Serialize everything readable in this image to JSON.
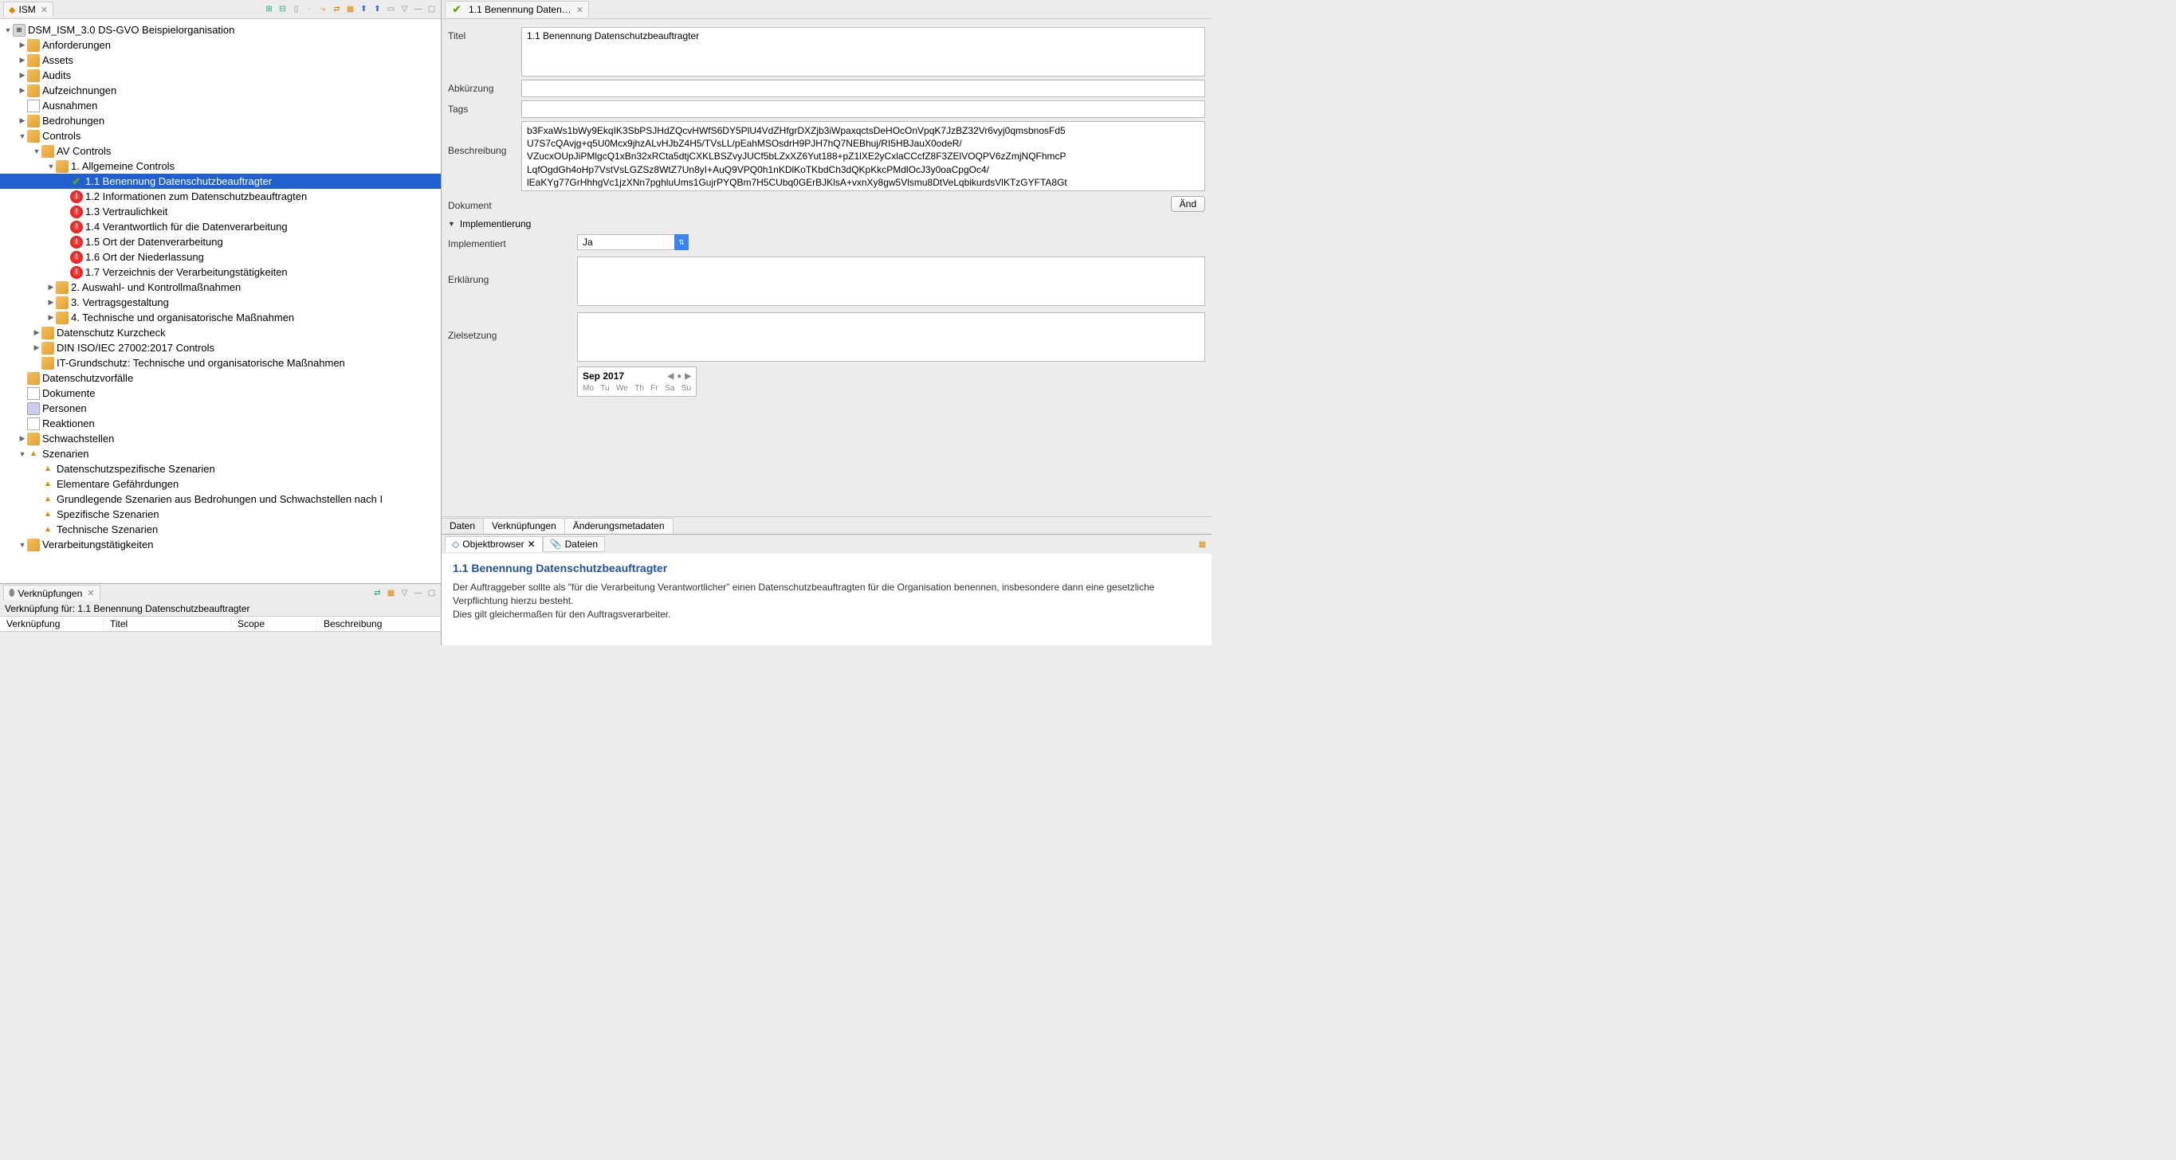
{
  "left": {
    "tab_label": "ISM",
    "tree": {
      "root": "DSM_ISM_3.0 DS-GVO Beispielorganisation",
      "items": [
        {
          "d": 1,
          "t": "Anforderungen",
          "i": "folder",
          "a": ">"
        },
        {
          "d": 1,
          "t": "Assets",
          "i": "folder",
          "a": ">"
        },
        {
          "d": 1,
          "t": "Audits",
          "i": "folder",
          "a": ">"
        },
        {
          "d": 1,
          "t": "Aufzeichnungen",
          "i": "folder",
          "a": ">"
        },
        {
          "d": 1,
          "t": "Ausnahmen",
          "i": "doc",
          "a": ""
        },
        {
          "d": 1,
          "t": "Bedrohungen",
          "i": "folder",
          "a": ">"
        },
        {
          "d": 1,
          "t": "Controls",
          "i": "folder",
          "a": "v"
        },
        {
          "d": 2,
          "t": "AV Controls",
          "i": "folder",
          "a": "v"
        },
        {
          "d": 3,
          "t": "1. Allgemeine Controls",
          "i": "folder",
          "a": "v"
        },
        {
          "d": 4,
          "t": "1.1 Benennung Datenschutzbeauftragter",
          "i": "chk",
          "a": "",
          "sel": true
        },
        {
          "d": 4,
          "t": "1.2 Informationen zum Datenschutzbeauftragten",
          "i": "err",
          "a": ""
        },
        {
          "d": 4,
          "t": "1.3 Vertraulichkeit",
          "i": "err",
          "a": ""
        },
        {
          "d": 4,
          "t": "1.4 Verantwortlich für die Datenverarbeitung",
          "i": "err",
          "a": ""
        },
        {
          "d": 4,
          "t": "1.5 Ort der Datenverarbeitung",
          "i": "err",
          "a": ""
        },
        {
          "d": 4,
          "t": "1.6 Ort der Niederlassung",
          "i": "err",
          "a": ""
        },
        {
          "d": 4,
          "t": "1.7 Verzeichnis der Verarbeitungstätigkeiten",
          "i": "err",
          "a": ""
        },
        {
          "d": 3,
          "t": "2. Auswahl- und Kontrollmaßnahmen",
          "i": "folder",
          "a": ">"
        },
        {
          "d": 3,
          "t": "3. Vertragsgestaltung",
          "i": "folder",
          "a": ">"
        },
        {
          "d": 3,
          "t": "4. Technische und organisatorische Maßnahmen",
          "i": "folder",
          "a": ">"
        },
        {
          "d": 2,
          "t": "Datenschutz Kurzcheck",
          "i": "folder",
          "a": ">"
        },
        {
          "d": 2,
          "t": "DIN ISO/IEC 27002:2017 Controls",
          "i": "folder",
          "a": ">"
        },
        {
          "d": 2,
          "t": "IT-Grundschutz: Technische und organisatorische Maßnahmen",
          "i": "folder",
          "a": ""
        },
        {
          "d": 1,
          "t": "Datenschutzvorfälle",
          "i": "folder",
          "a": ""
        },
        {
          "d": 1,
          "t": "Dokumente",
          "i": "doc",
          "a": ""
        },
        {
          "d": 1,
          "t": "Personen",
          "i": "person",
          "a": ""
        },
        {
          "d": 1,
          "t": "Reaktionen",
          "i": "doc",
          "a": ""
        },
        {
          "d": 1,
          "t": "Schwachstellen",
          "i": "folder",
          "a": ">"
        },
        {
          "d": 1,
          "t": "Szenarien",
          "i": "warn",
          "a": "v"
        },
        {
          "d": 2,
          "t": "Datenschutzspezifische Szenarien",
          "i": "warn",
          "a": ""
        },
        {
          "d": 2,
          "t": "Elementare Gefährdungen",
          "i": "warn",
          "a": ""
        },
        {
          "d": 2,
          "t": "Grundlegende Szenarien aus Bedrohungen und Schwachstellen nach I",
          "i": "warn",
          "a": ""
        },
        {
          "d": 2,
          "t": "Spezifische Szenarien",
          "i": "warn",
          "a": ""
        },
        {
          "d": 2,
          "t": "Technische Szenarien",
          "i": "warn",
          "a": ""
        },
        {
          "d": 1,
          "t": "Verarbeitungstätigkeiten",
          "i": "folder",
          "a": "v"
        }
      ]
    },
    "bottom": {
      "tab_label": "Verknüpfungen",
      "status": "Verknüpfung für: 1.1 Benennung Datenschutzbeauftragter",
      "cols": [
        "Verknüpfung",
        "Titel",
        "Scope",
        "Beschreibung"
      ]
    }
  },
  "right": {
    "tab_label": "1.1 Benennung Daten…",
    "form": {
      "titel_label": "Titel",
      "titel_value": "1.1 Benennung Datenschutzbeauftragter",
      "abk_label": "Abkürzung",
      "abk_value": "",
      "tags_label": "Tags",
      "tags_value": "",
      "beschr_label": "Beschreibung",
      "beschr_value": "b3FxaWs1bWy9EkqIK3SbPSJHdZQcvHWfS6DY5PlU4VdZHfgrDXZjb3iWpaxqctsDeHOcOnVpqK7JzBZ32Vr6vyj0qmsbnosFd5\nU7S7cQAvjg+q5U0Mcx9jhzALvHJbZ4H5/TVsLL/pEahMSOsdrH9PJH7hQ7NEBhuj/RI5HBJauX0odeR/\nVZucxOUpJiPMlgcQ1xBn32xRCta5dtjCXKLBSZvyJUCf5bLZxXZ6Yut188+pZ1lXE2yCxlaCCcfZ8F3ZElVOQPV6zZmjNQFhmcP\nLqfOgdGh4oHp7VstVsLGZSz8WtZ7Un8yI+AuQ9VPQ0h1nKDlKoTKbdCh3dQKpKkcPMdlOcJ3y0oaCpgOc4/\nlEaKYg77GrHhhgVc1jzXNn7pghluUms1GujrPYQBm7H5CUbq0GErBJKlsA+vxnXy8gw5Vlsmu8DtVeLqbikurdsVlKTzGYFTA8Gt",
      "dokument_label": "Dokument",
      "dokument_btn": "Änd",
      "impl_section": "Implementierung",
      "impl_label": "Implementiert",
      "impl_value": "Ja",
      "erkl_label": "Erklärung",
      "erkl_value": "",
      "ziel_label": "Zielsetzung",
      "ziel_value": "",
      "cal_month": "Sep 2017",
      "cal_days": [
        "Mo",
        "Tu",
        "We",
        "Th",
        "Fr",
        "Sa",
        "Su"
      ]
    },
    "bottom_tabs": [
      "Daten",
      "Verknüpfungen",
      "Änderungsmetadaten"
    ],
    "objbrowser": {
      "tab1": "Objektbrowser",
      "tab2": "Dateien",
      "title": "1.1 Benennung Datenschutzbeauftragter",
      "text1": "Der Auftraggeber sollte als \"für die Verarbeitung Verantwortlicher\" einen Datenschutzbeauftragten für die Organisation benennen, insbesondere dann eine gesetzliche Verpflichtung hierzu besteht.",
      "text2": "Dies gilt gleichermaßen für den Auftragsverarbeiter."
    }
  }
}
